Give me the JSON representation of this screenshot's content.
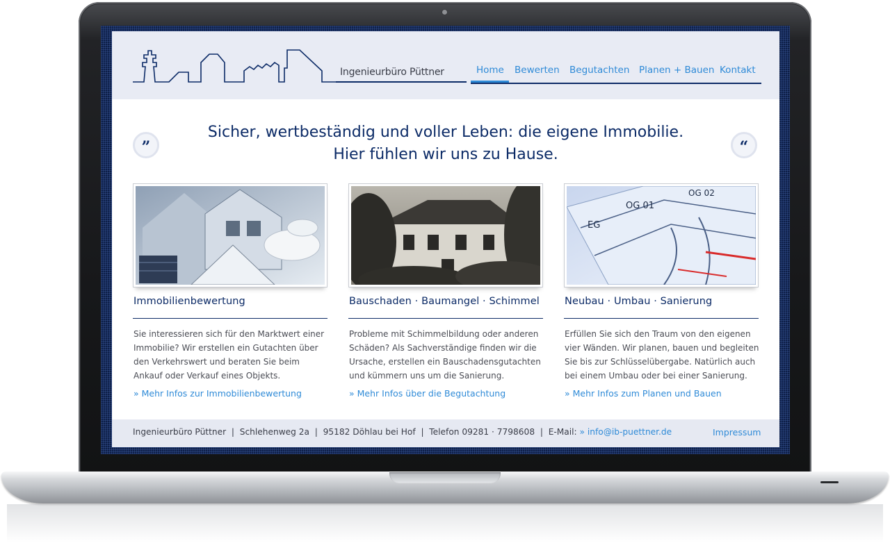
{
  "logo": {
    "brand": "Ingenieurbüro",
    "name": "Püttner",
    "icon": "skyline-logo-icon"
  },
  "nav": {
    "items": [
      {
        "label": "Home",
        "active": true
      },
      {
        "label": "Bewerten"
      },
      {
        "label": "Begutachten"
      },
      {
        "label": "Planen + Bauen"
      },
      {
        "label": "Kontakt"
      }
    ]
  },
  "hero": {
    "line1": "Sicher, wertbeständig und voller Leben: die eigene Immobilie.",
    "line2": "Hier fühlen wir uns zu Hause.",
    "quote_left": "”",
    "quote_right": "“"
  },
  "columns": [
    {
      "image": "modern-house-plans-photo",
      "title": "Immobilienbewertung",
      "text": "Sie interessieren sich für den Marktwert einer Immobilie? Wir erstellen ein Gutachten über den Verkehrswert und beraten Sie beim Ankauf oder Verkauf eines Objekts.",
      "link": "» Mehr Infos zur Immobilienbewertung"
    },
    {
      "image": "old-house-damage-photo",
      "title": "Bauschaden · Baumangel · Schimmel",
      "text": "Probleme mit Schimmelbildung oder anderen Schäden? Als Sachverständige finden wir die Ursache, erstellen ein Bauschadensgutachten und kümmern uns um die Sanierung.",
      "link": "» Mehr Infos über die Begutachtung"
    },
    {
      "image": "floor-plans-photo",
      "title": "Neubau · Umbau · Sanierung",
      "text": "Erfüllen Sie sich den Traum von den eigenen vier Wänden. Wir planen, bauen und begleiten Sie bis zur Schlüsselübergabe. Natürlich auch bei einem Umbau oder bei einer Sanierung.",
      "link": "» Mehr Infos zum Planen und Bauen"
    }
  ],
  "footer": {
    "company": "Ingenieurbüro Püttner",
    "street": "Schlehenweg 2a",
    "city": "95182 Döhlau bei Hof",
    "phone": "Telefon 09281 · 7798608",
    "email_label": "E-Mail:",
    "email": "» info@ib-puettner.de",
    "separator": "|",
    "impressum": "Impressum"
  },
  "colors": {
    "navy": "#0b2a66",
    "link_blue": "#2e8ad7",
    "header_bg": "#e8ebf4"
  }
}
